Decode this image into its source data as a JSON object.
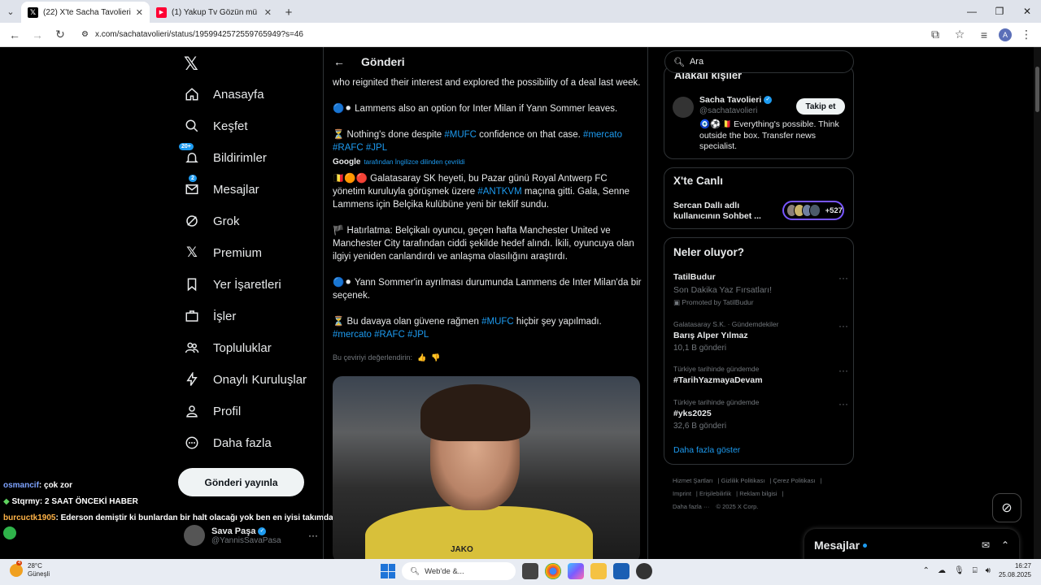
{
  "browser": {
    "tabs": [
      {
        "title": "(22) X'te Sacha Tavolieri: \"a",
        "favicon": "X",
        "active": true
      },
      {
        "title": "(1) Yakup Tv Gözün mü açıldı -",
        "favicon": "▶",
        "active": false
      }
    ],
    "url": "x.com/sachatavolieri/status/1959942572559765949?s=46"
  },
  "nav": {
    "items": [
      {
        "label": "Anasayfa",
        "icon": "home-icon"
      },
      {
        "label": "Keşfet",
        "icon": "search-icon"
      },
      {
        "label": "Bildirimler",
        "icon": "bell-icon",
        "badge": "20+"
      },
      {
        "label": "Mesajlar",
        "icon": "mail-icon",
        "badge": "2"
      },
      {
        "label": "Grok",
        "icon": "grok-icon"
      },
      {
        "label": "Premium",
        "icon": "x-icon"
      },
      {
        "label": "Yer İşaretleri",
        "icon": "bookmark-icon"
      },
      {
        "label": "İşler",
        "icon": "briefcase-icon"
      },
      {
        "label": "Topluluklar",
        "icon": "people-icon"
      },
      {
        "label": "Onaylı Kuruluşlar",
        "icon": "lightning-icon"
      },
      {
        "label": "Profil",
        "icon": "person-icon"
      },
      {
        "label": "Daha fazla",
        "icon": "more-circle-icon"
      }
    ],
    "post_button": "Gönderi yayınla",
    "account": {
      "name": "Sava Paşa",
      "handle": "@YannisSavaPasa"
    }
  },
  "chat_overlay": [
    {
      "user": "osmancif",
      "message": ": çok zor"
    },
    {
      "user": "Stqrmy",
      "message": ": 2 SAAT ÖNCEKİ HABER"
    },
    {
      "user": "burcuctk1905",
      "message": ": Ederson demiştir ki bunlardan bir halt olacağı yok ben en iyisi takımda kalayım"
    }
  ],
  "post": {
    "header": "Gönderi",
    "p1": "who reignited their interest and explored the possibility of a deal last week.",
    "p2": "Lammens also an option for Inter Milan if Yann Sommer leaves.",
    "p3_a": "Nothing's done despite ",
    "p3_tag1": "#MUFC",
    "p3_b": " confidence on that case. ",
    "p3_tag2": "#mercato",
    "p3_tag3": "#RAFC",
    "p3_tag4": "#JPL",
    "google_brand": "Google",
    "google_note": "tarafından İngilizce dilinden çevrildi",
    "t1_a": "Galatasaray SK heyeti, bu Pazar günü Royal Antwerp FC yönetim kuruluyla görüşmek üzere ",
    "t1_tag": "#ANTKVM",
    "t1_b": " maçına gitti. Gala, Senne Lammens için Belçika kulübüne yeni bir teklif sundu.",
    "t2": "Hatırlatma: Belçikalı oyuncu, geçen hafta Manchester United ve Manchester City tarafından ciddi şekilde hedef alındı. İkili, oyuncuya olan ilgiyi yeniden canlandırdı ve anlaşma olasılığını araştırdı.",
    "t3": "Yann Sommer'in ayrılması durumunda Lammens de Inter Milan'da bir seçenek.",
    "t4_a": "Bu davaya olan güvene rağmen ",
    "t4_tag1": "#MUFC",
    "t4_b": " hiçbir şey yapılmadı.",
    "t4_tag2": "#mercato",
    "t4_tag3": "#RAFC",
    "t4_tag4": "#JPL",
    "rate_label": "Bu çeviriyi değerlendirin:",
    "shirt_text": "JAKO"
  },
  "right": {
    "search_placeholder": "Ara",
    "related_header": "Alakalı kişiler",
    "person": {
      "name": "Sacha Tavolieri",
      "handle": "@sachatavolieri",
      "bio": "Everything's possible. Think outside the box. Transfer news specialist.",
      "follow": "Takip et"
    },
    "live_header": "X'te Canlı",
    "live_text": "Sercan Dallı adlı kullanıcının Sohbet ...",
    "live_count": "+527",
    "trends_header": "Neler oluyor?",
    "trends": [
      {
        "context": "",
        "name": "TatilBudur",
        "sub": "Son Dakika Yaz Fırsatları!",
        "promo": "Promoted by TatilBudur"
      },
      {
        "context": "Galatasaray S.K. · Gündemdekiler",
        "name": "Barış Alper Yılmaz",
        "sub": "10,1 B gönderi"
      },
      {
        "context": "Türkiye tarihinde gündemde",
        "name": "#TarihYazmayaDevam",
        "sub": ""
      },
      {
        "context": "Türkiye tarihinde gündemde",
        "name": "#yks2025",
        "sub": "32,6 B gönderi"
      }
    ],
    "show_more": "Daha fazla göster",
    "footer": [
      "Hizmet Şartları",
      "Gizlilik Politikası",
      "Çerez Politikası",
      "Imprint",
      "Erişilebilirlik",
      "Reklam bilgisi",
      "Daha fazla ···",
      "© 2025 X Corp."
    ]
  },
  "messages_drawer": "Mesajlar",
  "taskbar": {
    "weather_temp": "28°C",
    "weather_desc": "Güneşli",
    "weather_badge": "4",
    "search_placeholder": "Web'de &...",
    "time": "16:27",
    "date": "25.08.2025"
  }
}
